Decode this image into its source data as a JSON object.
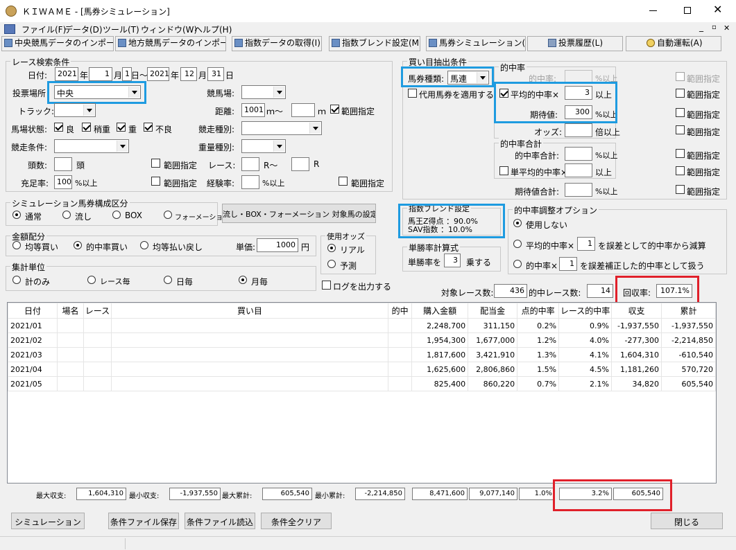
{
  "window": {
    "title": "ＫＩＷＡＭＥ - [馬券シミュレーション]"
  },
  "menu": [
    "ファイル(F)",
    "データ(D)",
    "ツール(T)",
    "ウィンドウ(W)",
    "ヘルプ(H)"
  ],
  "toolbar": [
    "中央競馬データのインポート(J)",
    "地方競馬データのインポート(N)",
    "指数データの取得(I)",
    "指数ブレンド設定(M)",
    "馬券シミュレーション(B)",
    "投票履歴(L)",
    "自動運転(A)"
  ],
  "race_search": {
    "title": "レース検索条件",
    "date_label": "日付:",
    "from_year": "2021",
    "year_unit": "年",
    "from_month": "1",
    "month_unit": "月",
    "from_day": "1",
    "day_tilde": "日～",
    "to_year": "2021",
    "to_month": "12",
    "to_day": "31",
    "day_unit": "日",
    "venue_label": "投票場所",
    "venue_value": "中央",
    "racecourse_label": "競馬場:",
    "track_label": "トラック:",
    "distance_label": "距離:",
    "distance_from": "1001",
    "m_tilde": "ｍ～",
    "m_unit": "ｍ",
    "range_label": "範囲指定",
    "condition_label": "馬場状態:",
    "cond_good": "良",
    "cond_slightly": "稍重",
    "cond_heavy": "重",
    "cond_bad": "不良",
    "race_type_label": "競走種別:",
    "race_cond_label": "競走条件:",
    "weight_type_label": "重量種別:",
    "heads_label": "頭数:",
    "heads_unit": "頭",
    "race_label": "レース:",
    "race_r_tilde": "R～",
    "race_r": "R",
    "fill_rate_label": "充足率:",
    "fill_rate_value": "100",
    "pct_above": "%以上",
    "exp_rate_label": "経験率:"
  },
  "sim_type": {
    "title": "シミュレーション馬券構成区分",
    "options": [
      "通常",
      "流し",
      "BOX",
      "フォーメーション"
    ],
    "setup_button": "流し・BOX・フォーメーション 対象馬の設定"
  },
  "amount": {
    "title": "金額配分",
    "options": [
      "均等買い",
      "的中率買い",
      "均等払い戻し"
    ],
    "unit_label": "単価:",
    "unit_value": "1000",
    "yen": "円"
  },
  "odds": {
    "title": "使用オッズ",
    "options": [
      "リアル",
      "予測"
    ]
  },
  "aggregate": {
    "title": "集計単位",
    "options": [
      "計のみ",
      "レース毎",
      "日毎",
      "月毎"
    ],
    "log_label": "ログを出力する"
  },
  "bet_extract": {
    "title": "買い目抽出条件",
    "ticket_type_label": "馬券種類:",
    "ticket_type_value": "馬連",
    "substitute_label": "代用馬券を適用する",
    "hit_title": "的中率",
    "hit_rate_label": "的中率:",
    "pct_above": "%以上",
    "avg_hit_label": "平均的中率×",
    "avg_hit_value": "3",
    "above": "以上",
    "expect_label": "期待値:",
    "expect_value": "300",
    "odds_label": "オッズ:",
    "times_above": "倍以上",
    "hit_total_title": "的中率合計",
    "hit_total_label": "的中率合計:",
    "single_avg_label": "単平均的中率×",
    "expect_total_label": "期待値合計:",
    "range_label": "範囲指定"
  },
  "blend": {
    "title": "指数ブレンド設定",
    "line1": "馬王Z得点 ：90.0%",
    "line2": "SAV指数 ：10.0%"
  },
  "win_calc": {
    "title": "単勝率計算式",
    "label": "単勝率を",
    "value": "3",
    "suffix": "乗する"
  },
  "adjust": {
    "title": "的中率調整オプション",
    "options": [
      "使用しない",
      "平均的中率×",
      "的中率×"
    ],
    "opt2_value": "1",
    "opt2_suffix": "を誤差として的中率から減算",
    "opt3_value": "1",
    "opt3_suffix": "を誤差補正した的中率として扱う"
  },
  "summary_top": {
    "target_label": "対象レース数:",
    "target_value": "436",
    "hit_label": "的中レース数:",
    "hit_value": "14",
    "recovery_label": "回収率:",
    "recovery_value": "107.1%"
  },
  "table": {
    "headers": [
      "日付",
      "場名",
      "レース",
      "買い目",
      "的中",
      "購入金額",
      "配当金",
      "点的中率",
      "レース的中率",
      "収支",
      "累計"
    ],
    "rows": [
      [
        "2021/01",
        "",
        "",
        "",
        "",
        "2,248,700",
        "311,150",
        "0.2%",
        "0.9%",
        "-1,937,550",
        "-1,937,550"
      ],
      [
        "2021/02",
        "",
        "",
        "",
        "",
        "1,954,300",
        "1,677,000",
        "1.2%",
        "4.0%",
        "-277,300",
        "-2,214,850"
      ],
      [
        "2021/03",
        "",
        "",
        "",
        "",
        "1,817,600",
        "3,421,910",
        "1.3%",
        "4.1%",
        "1,604,310",
        "-610,540"
      ],
      [
        "2021/04",
        "",
        "",
        "",
        "",
        "1,625,600",
        "2,806,860",
        "1.5%",
        "4.5%",
        "1,181,260",
        "570,720"
      ],
      [
        "2021/05",
        "",
        "",
        "",
        "",
        "825,400",
        "860,220",
        "0.7%",
        "2.1%",
        "34,820",
        "605,540"
      ]
    ]
  },
  "summary_bottom": {
    "max_balance_label": "最大収支:",
    "max_balance": "1,604,310",
    "min_balance_label": "最小収支:",
    "min_balance": "-1,937,550",
    "max_cum_label": "最大累計:",
    "max_cum": "605,540",
    "min_cum_label": "最小累計:",
    "min_cum": "-2,214,850",
    "total_purchase": "8,471,600",
    "total_payout": "9,077,140",
    "total_point_hit": "1.0%",
    "total_race_hit": "3.2%",
    "total_balance": "605,540"
  },
  "buttons": {
    "simulate": "シミュレーション",
    "save": "条件ファイル保存",
    "load": "条件ファイル読込",
    "clear": "条件全クリア",
    "close": "閉じる"
  }
}
